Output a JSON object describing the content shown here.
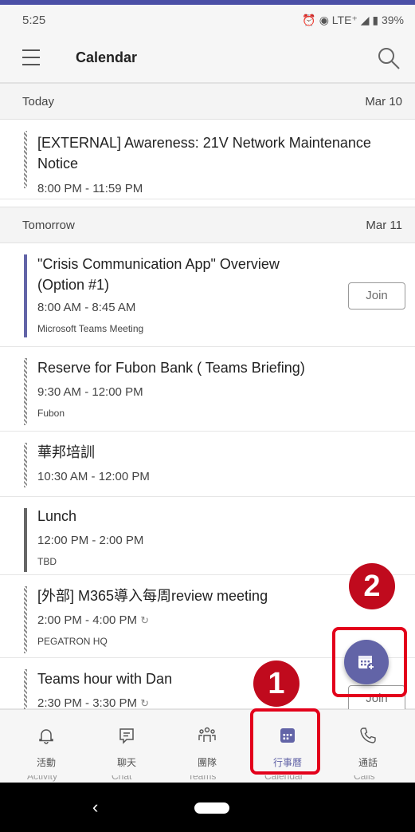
{
  "status_bar": {
    "time": "5:25",
    "indicators": "⏰ ◉ LTE⁺ ◢ ▮ 39%"
  },
  "app_bar": {
    "title": "Calendar"
  },
  "days": [
    {
      "label": "Today",
      "date": "Mar 10"
    },
    {
      "label": "Tomorrow",
      "date": "Mar 11"
    }
  ],
  "events": [
    {
      "title_line1": "[EXTERNAL] Awareness: 21V Network Maintenance",
      "title_line2": "Notice",
      "time": "8:00 PM - 11:59 PM",
      "location": ""
    },
    {
      "title_line1": "\"Crisis Communication App\" Overview",
      "title_line2": "(Option #1)",
      "time": "8:00 AM - 8:45 AM",
      "location": "Microsoft Teams Meeting",
      "join": "Join"
    },
    {
      "title_line1": "Reserve for Fubon Bank ( Teams Briefing)",
      "time": "9:30 AM - 12:00 PM",
      "location": "Fubon"
    },
    {
      "title_line1": "華邦培訓",
      "time": "10:30 AM - 12:00 PM",
      "location": ""
    },
    {
      "title_line1": "Lunch",
      "time": "12:00 PM - 2:00 PM",
      "location": "TBD"
    },
    {
      "title_line1": "[外部] M365導入每周review meeting",
      "time": "2:00 PM - 4:00 PM",
      "location": "PEGATRON HQ"
    },
    {
      "title_line1": "Teams hour with Dan",
      "time": "2:30 PM - 3:30 PM",
      "location": "",
      "join": "Join"
    }
  ],
  "annotations": {
    "callout_1": "1",
    "callout_2": "2"
  },
  "bottom_nav": [
    {
      "label": "活動",
      "icon": "bell-icon"
    },
    {
      "label": "聊天",
      "icon": "chat-icon"
    },
    {
      "label": "團隊",
      "icon": "teams-icon"
    },
    {
      "label": "行事曆",
      "icon": "calendar-icon",
      "active": true
    },
    {
      "label": "通話",
      "icon": "phone-icon"
    }
  ],
  "bottom_nav_ghost": [
    "Activity",
    "Chat",
    "Teams",
    "Calendar",
    "Calls"
  ],
  "colors": {
    "accent": "#6264a7",
    "callout": "#c00a1d",
    "highlight_box": "#e3001b"
  }
}
